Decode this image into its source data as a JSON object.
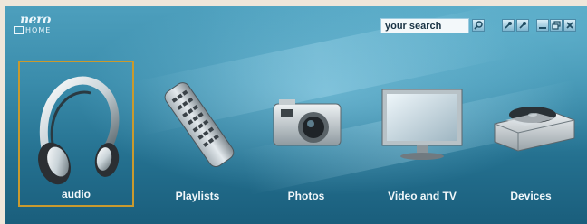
{
  "app": {
    "logo_top": "nero",
    "logo_bottom": "HOME"
  },
  "search": {
    "value": "your search"
  },
  "window_controls": [
    "pin-icon",
    "pin-icon",
    "minimize-icon",
    "restore-icon",
    "close-icon"
  ],
  "tiles": [
    {
      "label": "audio",
      "icon": "headphones-icon",
      "selected": true
    },
    {
      "label": "Playlists",
      "icon": "remote-control-icon",
      "selected": false
    },
    {
      "label": "Photos",
      "icon": "camera-icon",
      "selected": false
    },
    {
      "label": "Video and TV",
      "icon": "monitor-icon",
      "selected": false
    },
    {
      "label": "Devices",
      "icon": "optical-drive-icon",
      "selected": false
    }
  ],
  "colors": {
    "accent_border": "#c99a2e",
    "background": "#3a8cab"
  }
}
